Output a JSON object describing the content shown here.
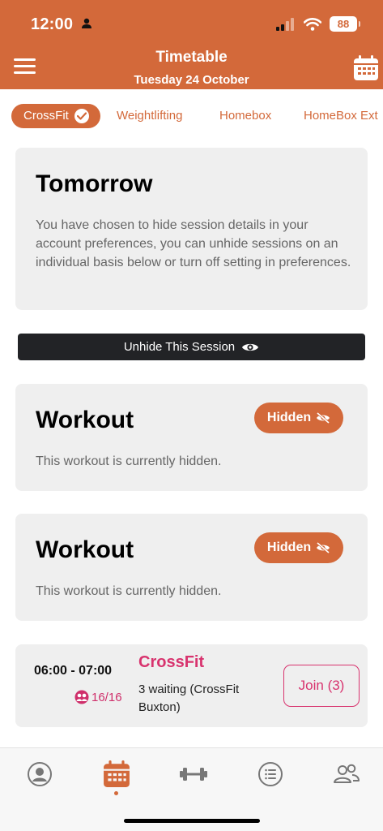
{
  "status_bar": {
    "time": "12:00",
    "battery": "88"
  },
  "header": {
    "title": "Timetable",
    "date": "Tuesday 24 October"
  },
  "tabs": [
    {
      "label": "CrossFit",
      "active": true
    },
    {
      "label": "Weightlifting",
      "active": false
    },
    {
      "label": "Homebox",
      "active": false
    },
    {
      "label": "HomeBox Ext",
      "active": false
    }
  ],
  "notice": {
    "title": "Tomorrow",
    "text": "You have chosen to hide session details in your account preferences, you can unhide sessions on an individual basis below or turn off setting in preferences."
  },
  "unhide_button": {
    "label": "Unhide This Session"
  },
  "workouts": [
    {
      "title": "Workout",
      "badge": "Hidden",
      "text": "This workout is currently hidden."
    },
    {
      "title": "Workout",
      "badge": "Hidden",
      "text": "This workout is currently hidden."
    }
  ],
  "session": {
    "time": "06:00 - 07:00",
    "capacity": "16/16",
    "name": "CrossFit",
    "waiting": "3 waiting (CrossFit Buxton)",
    "join_label": "Join (3)"
  },
  "tab_bar": {
    "items": [
      {
        "icon": "profile-icon",
        "active": false
      },
      {
        "icon": "calendar-icon",
        "active": true
      },
      {
        "icon": "dumbbell-icon",
        "active": false
      },
      {
        "icon": "list-icon",
        "active": false
      },
      {
        "icon": "people-icon",
        "active": false
      }
    ]
  },
  "colors": {
    "brand": "#d3693a",
    "accent": "#d8336e",
    "card": "#efefef",
    "dark_button": "#222326"
  }
}
